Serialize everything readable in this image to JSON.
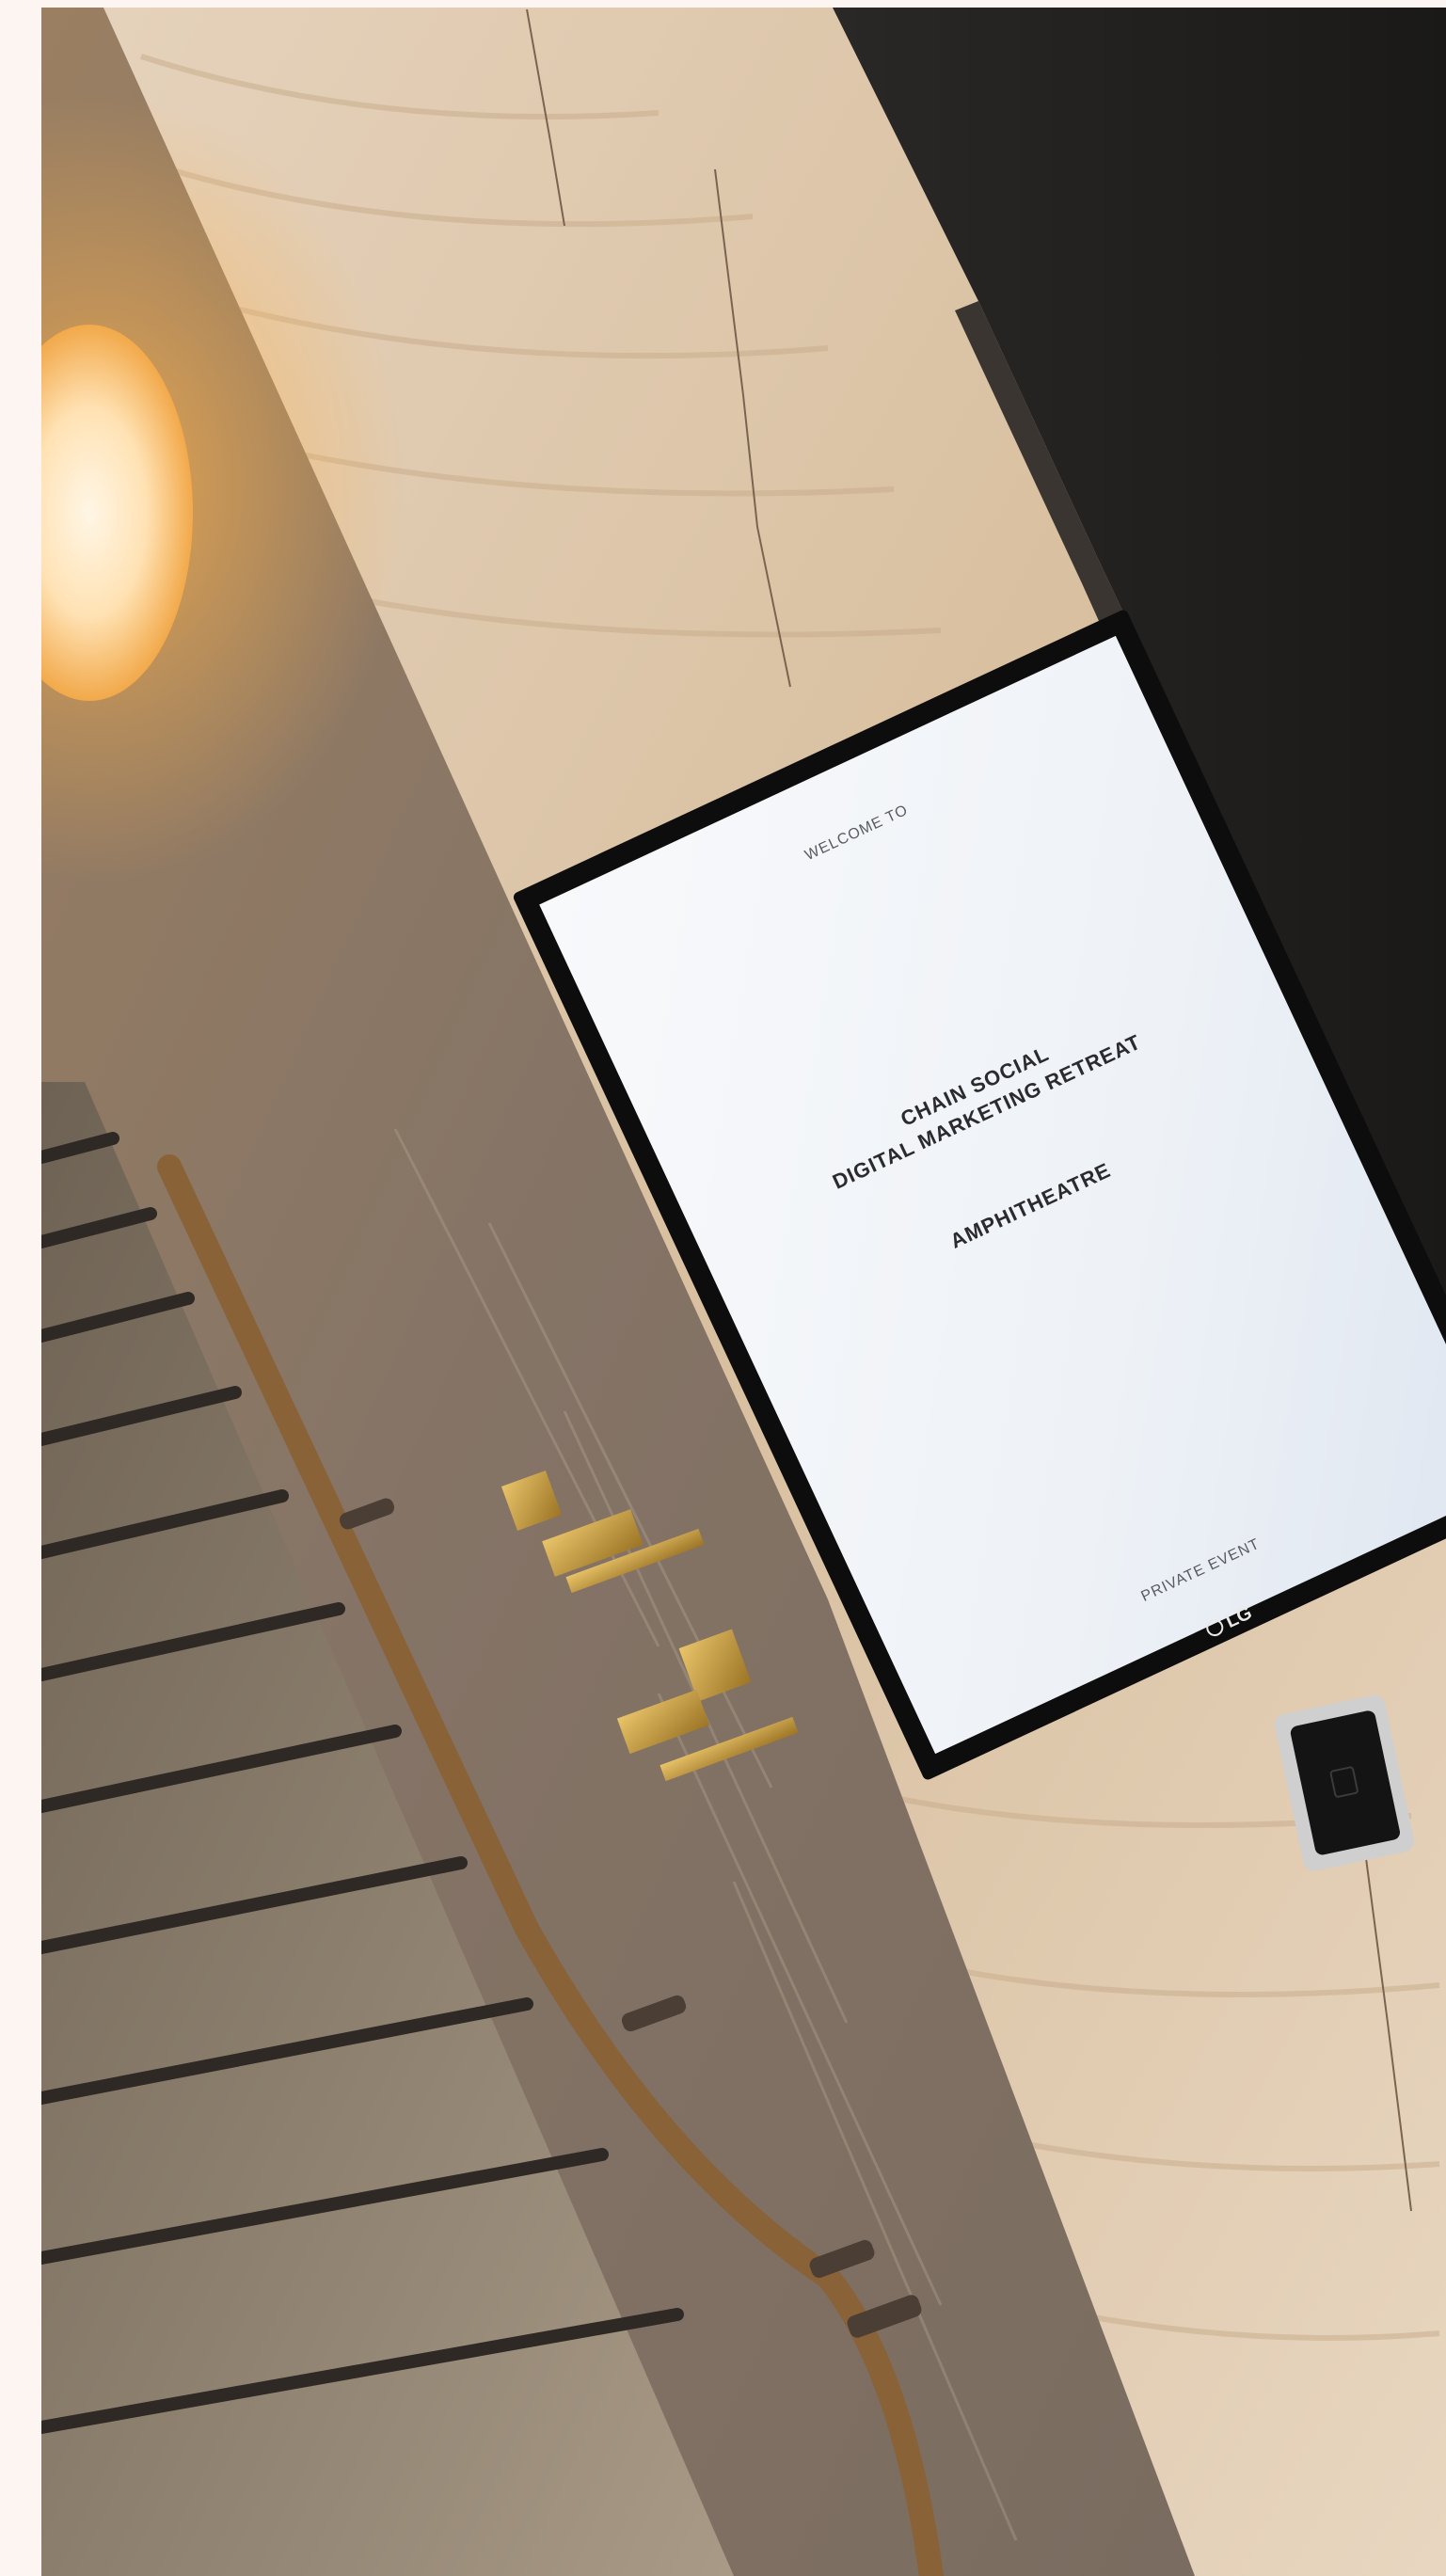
{
  "photo": {
    "subject": "welcome-screen-on-marble-wall-beside-staircase",
    "colors": {
      "page_border": "#fcf5f1",
      "travertine": "#dcc5aa",
      "grey_marble": "#8a7868",
      "dark_wall": "#1f1e1c",
      "stairs": "#9a8a76",
      "stair_stripe": "#2e2925",
      "lamp_glow": "#ffd9a0",
      "brass": "#c79a3c",
      "screen_bezel": "#0d0d0e",
      "screen_face": "#f2f5f9"
    }
  },
  "signage": {
    "welcome": "WELCOME TO",
    "event_line_1": "CHAIN SOCIAL",
    "event_line_2": "DIGITAL MARKETING RETREAT",
    "venue": "AMPHITHEATRE",
    "footer": "PRIVATE EVENT",
    "brand": "LG"
  }
}
